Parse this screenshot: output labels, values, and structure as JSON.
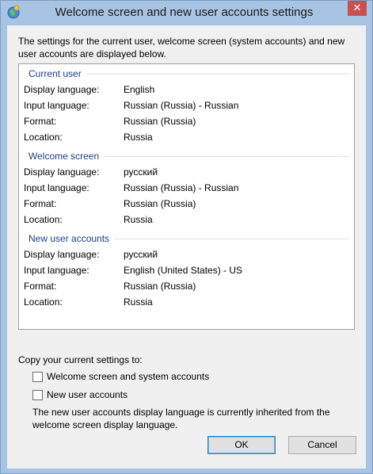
{
  "window": {
    "title": "Welcome screen and new user accounts settings",
    "close_glyph": "✕",
    "close_color": "#c75050"
  },
  "description": "The settings for the current user, welcome screen (system accounts) and new user accounts are displayed below.",
  "groups": [
    {
      "title": "Current user",
      "rows": [
        {
          "label": "Display language:",
          "value": "English"
        },
        {
          "label": "Input language:",
          "value": "Russian (Russia) - Russian"
        },
        {
          "label": "Format:",
          "value": "Russian (Russia)"
        },
        {
          "label": "Location:",
          "value": "Russia"
        }
      ]
    },
    {
      "title": "Welcome screen",
      "rows": [
        {
          "label": "Display language:",
          "value": "русский"
        },
        {
          "label": "Input language:",
          "value": "Russian (Russia) - Russian"
        },
        {
          "label": "Format:",
          "value": "Russian (Russia)"
        },
        {
          "label": "Location:",
          "value": "Russia"
        }
      ]
    },
    {
      "title": "New user accounts",
      "rows": [
        {
          "label": "Display language:",
          "value": "русский"
        },
        {
          "label": "Input language:",
          "value": "English (United States) - US"
        },
        {
          "label": "Format:",
          "value": "Russian (Russia)"
        },
        {
          "label": "Location:",
          "value": "Russia"
        }
      ]
    }
  ],
  "copy": {
    "label": "Copy your current settings to:",
    "options": [
      {
        "label": "Welcome screen and system accounts",
        "checked": false
      },
      {
        "label": "New user accounts",
        "checked": false
      }
    ],
    "note": "The new user accounts display language is currently inherited from the welcome screen display language."
  },
  "buttons": {
    "ok": "OK",
    "cancel": "Cancel"
  },
  "colors": {
    "frame": "#a9c4e3",
    "group_title": "#1e3f8a"
  }
}
